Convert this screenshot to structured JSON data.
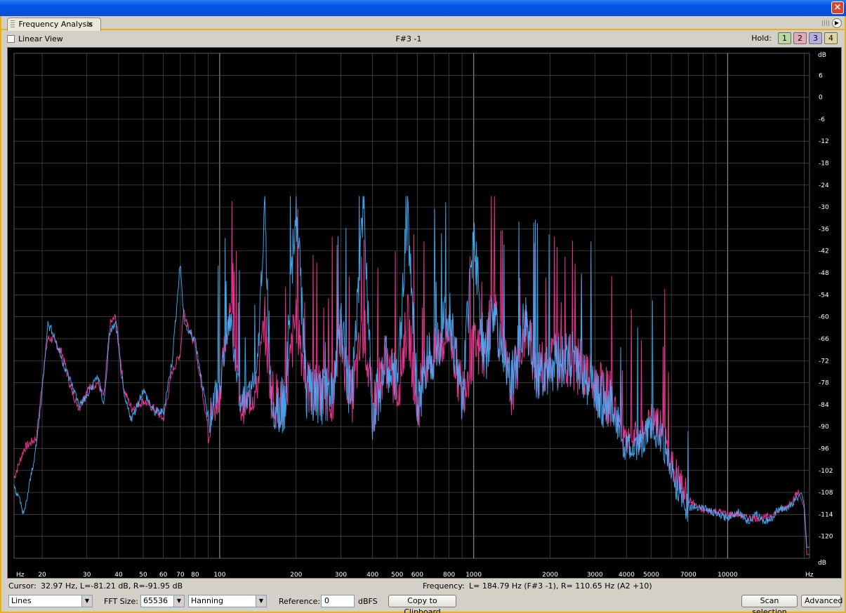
{
  "window": {
    "close_icon": "×"
  },
  "tab": {
    "label": "Frequency Analysis",
    "close": "×",
    "menu_icon": "▶"
  },
  "toolbar": {
    "linear_view_label": "Linear View",
    "note": "F#3 -1",
    "hold_label": "Hold:",
    "hold_buttons": [
      {
        "label": "1",
        "color": "#b9d7a3"
      },
      {
        "label": "2",
        "color": "#e3a9b6"
      },
      {
        "label": "3",
        "color": "#b5aee0"
      },
      {
        "label": "4",
        "color": "#dfd5a0"
      }
    ]
  },
  "plot": {
    "background": "#000000",
    "grid_color": "#5a5a5a",
    "left_channel_color": "#ff3aa0",
    "right_channel_color": "#45b4ff",
    "x_axis": {
      "unit": "Hz",
      "range": [
        15.5,
        21000
      ],
      "scale": "log",
      "ticks": [
        {
          "value": 20,
          "label": "20"
        },
        {
          "value": 30,
          "label": "30"
        },
        {
          "value": 40,
          "label": "40"
        },
        {
          "value": 50,
          "label": "50"
        },
        {
          "value": 60,
          "label": "60"
        },
        {
          "value": 70,
          "label": "70"
        },
        {
          "value": 80,
          "label": "80"
        },
        {
          "value": 100,
          "label": "100"
        },
        {
          "value": 200,
          "label": "200"
        },
        {
          "value": 300,
          "label": "300"
        },
        {
          "value": 400,
          "label": "400"
        },
        {
          "value": 500,
          "label": "500"
        },
        {
          "value": 600,
          "label": "600"
        },
        {
          "value": 800,
          "label": "800"
        },
        {
          "value": 1000,
          "label": "1000"
        },
        {
          "value": 2000,
          "label": "2000"
        },
        {
          "value": 3000,
          "label": "3000"
        },
        {
          "value": 4000,
          "label": "4000"
        },
        {
          "value": 5000,
          "label": "5000"
        },
        {
          "value": 7000,
          "label": "7000"
        },
        {
          "value": 10000,
          "label": "10000"
        }
      ]
    },
    "y_axis": {
      "unit": "dB",
      "range": [
        -126,
        12
      ],
      "ticks": [
        6,
        0,
        -6,
        -12,
        -18,
        -24,
        -30,
        -36,
        -42,
        -48,
        -54,
        -60,
        -66,
        -72,
        -78,
        -84,
        -90,
        -96,
        -102,
        -108,
        -114,
        -120
      ]
    }
  },
  "chart_data": {
    "type": "line",
    "x_unit": "Hz",
    "y_unit": "dB",
    "x_scale": "log",
    "xlim": [
      15.5,
      21000
    ],
    "ylim": [
      -126,
      12
    ],
    "grid": true,
    "series": [
      {
        "x": [
          15.5,
          17,
          19,
          20,
          21,
          22,
          24,
          26,
          28,
          30,
          33,
          35,
          37,
          39,
          42,
          45,
          50,
          55,
          60,
          65,
          70,
          72,
          75,
          80,
          90,
          100,
          110,
          120,
          140,
          150,
          160,
          180,
          200,
          220,
          250,
          280,
          300,
          330,
          370,
          400,
          450,
          500,
          550,
          600,
          650,
          700,
          800,
          900,
          1000,
          1100,
          1200,
          1400,
          1600,
          1800,
          2000,
          2500,
          3000,
          3500,
          4000,
          4500,
          5000,
          5500,
          6000,
          7000,
          8000,
          9000,
          10000,
          11000,
          12000,
          13000,
          14000,
          15000,
          16000,
          17000,
          18000,
          19000,
          19500,
          20000,
          20500
        ],
        "y": [
          -104,
          -96,
          -93,
          -78,
          -66,
          -66,
          -70,
          -80,
          -85,
          -80,
          -78,
          -82,
          -62,
          -60,
          -80,
          -85,
          -83,
          -85,
          -88,
          -75,
          -70,
          -58,
          -62,
          -68,
          -90,
          -80,
          -55,
          -85,
          -80,
          -60,
          -80,
          -85,
          -58,
          -78,
          -80,
          -80,
          -65,
          -82,
          -62,
          -85,
          -70,
          -80,
          -60,
          -85,
          -70,
          -70,
          -62,
          -80,
          -68,
          -70,
          -55,
          -80,
          -62,
          -75,
          -70,
          -72,
          -78,
          -82,
          -95,
          -92,
          -88,
          -90,
          -100,
          -110,
          -113,
          -113,
          -114,
          -114,
          -115,
          -115,
          -115,
          -114,
          -113,
          -112,
          -110,
          -108,
          -110,
          -112,
          -125
        ]
      },
      {
        "x": [
          15.5,
          17,
          19,
          20,
          21,
          22,
          24,
          26,
          28,
          30,
          33,
          35,
          37,
          39,
          42,
          45,
          50,
          55,
          60,
          65,
          70,
          72,
          75,
          80,
          90,
          100,
          110,
          120,
          140,
          150,
          160,
          180,
          200,
          220,
          250,
          280,
          300,
          330,
          370,
          400,
          450,
          500,
          550,
          600,
          650,
          700,
          800,
          900,
          1000,
          1100,
          1200,
          1400,
          1600,
          1800,
          2000,
          2500,
          3000,
          3500,
          4000,
          4500,
          5000,
          5500,
          6000,
          7000,
          8000,
          9000,
          10000,
          11000,
          12000,
          13000,
          14000,
          15000,
          16000,
          17000,
          18000,
          19000,
          19500,
          20000,
          20500
        ],
        "y": [
          -106,
          -114,
          -95,
          -80,
          -62,
          -64,
          -72,
          -78,
          -84,
          -82,
          -76,
          -84,
          -64,
          -62,
          -82,
          -88,
          -80,
          -86,
          -86,
          -72,
          -45,
          -60,
          -64,
          -66,
          -88,
          -78,
          -60,
          -82,
          -78,
          -30,
          -82,
          -84,
          -28,
          -80,
          -82,
          -78,
          -60,
          -84,
          -28,
          -86,
          -72,
          -78,
          -30,
          -84,
          -72,
          -68,
          -58,
          -82,
          -35,
          -72,
          -58,
          -78,
          -60,
          -76,
          -72,
          -70,
          -80,
          -84,
          -96,
          -94,
          -90,
          -92,
          -102,
          -112,
          -112,
          -114,
          -115,
          -113,
          -116,
          -114,
          -116,
          -115,
          -112,
          -113,
          -111,
          -109,
          -108,
          -111,
          -123
        ]
      }
    ]
  },
  "status": {
    "cursor_label": "Cursor:",
    "cursor_value": "32.97 Hz, L=-81.21 dB, R=-91.95 dB",
    "frequency_label": "Frequency:",
    "frequency_value": "L= 184.79 Hz (F#3 -1), R= 110.65 Hz (A2 +10)"
  },
  "controls": {
    "display_mode": "Lines",
    "fft_size_label": "FFT Size:",
    "fft_size": "65536",
    "window_function": "Hanning",
    "reference_label": "Reference:",
    "reference_value": "0",
    "reference_unit": "dBFS",
    "copy_button": "Copy to Clipboard",
    "scan_button": "Scan selection",
    "advanced_button": "Advanced"
  }
}
